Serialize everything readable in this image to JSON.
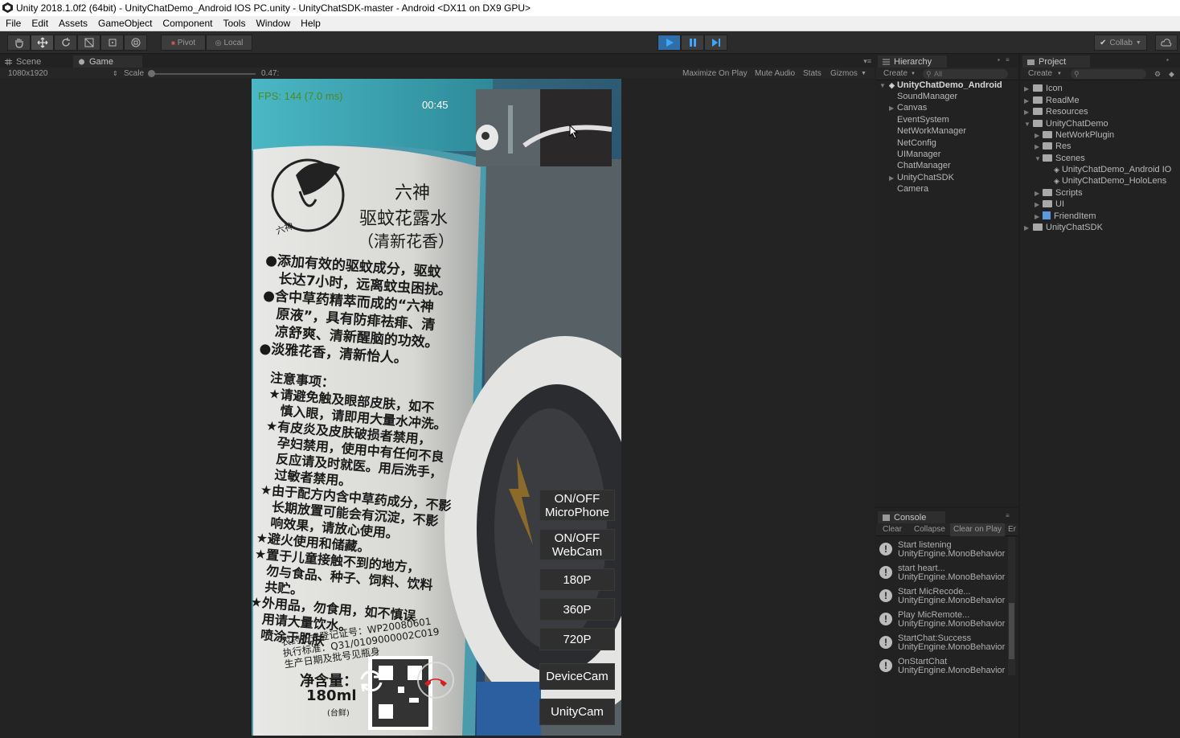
{
  "window": {
    "title": "Unity 2018.1.0f2 (64bit) - UnityChatDemo_Android IOS PC.unity - UnityChatSDK-master - Android <DX11 on DX9 GPU>"
  },
  "menu": [
    "File",
    "Edit",
    "Assets",
    "GameObject",
    "Component",
    "Tools",
    "Window",
    "Help"
  ],
  "toolbar": {
    "pivot": "Pivot",
    "local": "Local",
    "collab": "Collab"
  },
  "tabs": {
    "scene": "Scene",
    "game": "Game"
  },
  "game_bar": {
    "resolution": "1080x1920",
    "scale_label": "Scale",
    "scale_value": "0.47:",
    "maximize": "Maximize On Play",
    "mute": "Mute Audio",
    "stats": "Stats",
    "gizmos": "Gizmos"
  },
  "game": {
    "fps": "FPS: 144 (7.0 ms)",
    "timer": "00:45",
    "buttons": {
      "microphone_l1": "ON/OFF",
      "microphone_l2": "MicroPhone",
      "webcam_l1": "ON/OFF",
      "webcam_l2": "WebCam",
      "p180": "180P",
      "p360": "360P",
      "p720": "720P",
      "devicecam": "DeviceCam",
      "unitycam": "UnityCam"
    },
    "label_text": {
      "title1": "六神",
      "title2": "驱蚊花露水",
      "title3": "（清新花香）",
      "b1a": "●添加有效的驱蚊成分，驱蚊",
      "b1b": "长达7小时，远离蚊虫困扰。",
      "b2a": "●含中草药精萃而成的“六神",
      "b2b": "原液”，具有防痱祛痱、清",
      "b2c": "凉舒爽、清新醒脑的功效。",
      "b3": "●淡雅花香，清新怡人。",
      "n0": "注意事项：",
      "n1a": "★请避免触及眼部皮肤，如不",
      "n1b": "慎入眼，请即用大量水冲洗。",
      "n2a": "★有皮炎及皮肤破损者禁用，",
      "n2b": "孕妇禁用，使用中有任何不良",
      "n2c": "反应请及时就医。用后洗手，",
      "n2d": "过敏者禁用。",
      "n3a": "★由于配方内含中草药成分，不影",
      "n3b": "长期放置可能会有沉淀，不影",
      "n3c": "响效果，请放心使用。",
      "n4": "★避火使用和储藏。",
      "n5a": "★置于儿童接触不到的地方，",
      "n5b": "勿与食品、种子、饲料、饮料",
      "n5c": "共贮。",
      "n6a": "★外用品，勿食用，如不慎误",
      "n6b": "用请大量饮水。",
      "n6c": "喷涂于肌肤",
      "f1": "农药正式登记证号：WP20080601",
      "f2": "执行标准：Q31/0109000002C019",
      "f3": "生产日期及批号见瓶身",
      "f4": "净含量：",
      "f5": "180ml",
      "f6": "(台鲜)",
      "circle": "六神"
    }
  },
  "hierarchy": {
    "title": "Hierarchy",
    "create": "Create",
    "search": "All",
    "root": "UnityChatDemo_Android",
    "items": [
      "SoundManager",
      "Canvas",
      "EventSystem",
      "NetWorkManager",
      "NetConfig",
      "UIManager",
      "ChatManager",
      "UnityChatSDK",
      "Camera"
    ]
  },
  "project": {
    "title": "Project",
    "create": "Create",
    "items": [
      "Icon",
      "ReadMe",
      "Resources",
      "UnityChatDemo",
      "NetWorkPlugin",
      "Res",
      "Scenes",
      "UnityChatDemo_Android IO",
      "UnityChatDemo_HoloLens",
      "Scripts",
      "UI",
      "FriendItem",
      "UnityChatSDK"
    ]
  },
  "console": {
    "title": "Console",
    "clear": "Clear",
    "collapse": "Collapse",
    "clear_on_play": "Clear on Play",
    "error_pause": "Er",
    "logs": [
      {
        "line1": "Start listening",
        "line2": "UnityEngine.MonoBehavior"
      },
      {
        "line1": "start heart...",
        "line2": "UnityEngine.MonoBehavior"
      },
      {
        "line1": "Start MicRecode...",
        "line2": "UnityEngine.MonoBehavior"
      },
      {
        "line1": "Play MicRemote...",
        "line2": "UnityEngine.MonoBehavior"
      },
      {
        "line1": "StartChat:Success",
        "line2": "UnityEngine.MonoBehavior"
      },
      {
        "line1": "OnStartChat",
        "line2": "UnityEngine.MonoBehavior"
      }
    ]
  },
  "colors": {
    "accent": "#3ea6ff",
    "fps": "#4c8a2a",
    "hang_up": "#d42020"
  }
}
